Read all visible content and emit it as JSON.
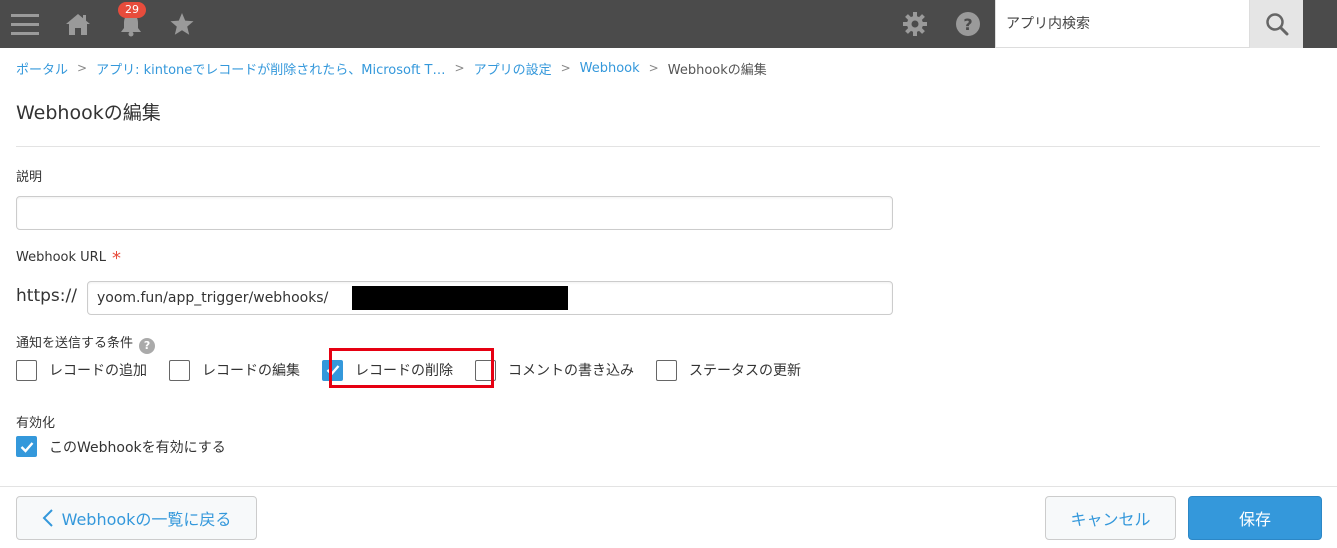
{
  "topbar": {
    "notification_count": "29",
    "search_placeholder": "アプリ内検索",
    "icons": [
      "menu-icon",
      "home-icon",
      "bell-icon",
      "star-icon",
      "gear-icon",
      "help-icon",
      "search-icon"
    ],
    "bg_color": "#4b4b4b"
  },
  "breadcrumb": {
    "items": [
      "ポータル",
      "アプリ: kintoneでレコードが削除されたら、Microsoft T…",
      "アプリの設定",
      "Webhook",
      "Webhookの編集"
    ],
    "separator": ">"
  },
  "page": {
    "title": "Webhookの編集"
  },
  "form": {
    "description_label": "説明",
    "description_value": "",
    "url_label": "Webhook URL",
    "required_mark": "*",
    "url_prefix": "https://",
    "url_value": "yoom.fun/app_trigger/webhooks/",
    "conditions_label": "通知を送信する条件",
    "conditions": [
      {
        "label": "レコードの追加",
        "checked": false
      },
      {
        "label": "レコードの編集",
        "checked": false
      },
      {
        "label": "レコードの削除",
        "checked": true
      },
      {
        "label": "コメントの書き込み",
        "checked": false
      },
      {
        "label": "ステータスの更新",
        "checked": false
      }
    ],
    "enable_label": "有効化",
    "enable_checkbox_label": "このWebhookを有効にする",
    "enable_checked": true
  },
  "footer": {
    "back_label": "Webhookの一覧に戻る",
    "cancel_label": "キャンセル",
    "save_label": "保存"
  },
  "colors": {
    "accent": "#3498db",
    "highlight": "#e60012",
    "badge": "#e74c3c"
  }
}
